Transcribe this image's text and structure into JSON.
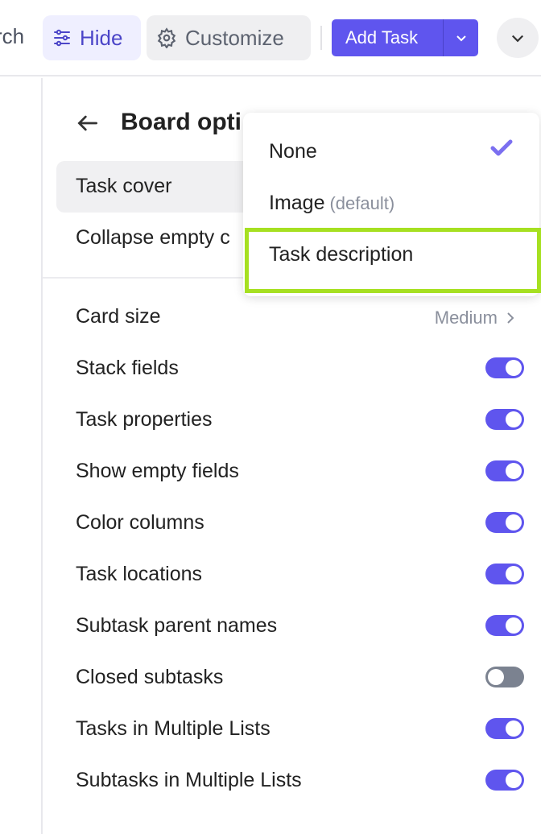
{
  "toolbar": {
    "search_label": "rch",
    "hide_label": "Hide",
    "customize_label": "Customize",
    "add_task_label": "Add Task"
  },
  "panel": {
    "title": "Board opti",
    "task_cover": "Task cover",
    "collapse_empty": "Collapse empty c",
    "card_size": {
      "label": "Card size",
      "value": "Medium"
    },
    "toggles": [
      {
        "label": "Stack fields",
        "on": true
      },
      {
        "label": "Task properties",
        "on": true
      },
      {
        "label": "Show empty fields",
        "on": true
      },
      {
        "label": "Color columns",
        "on": true
      },
      {
        "label": "Task locations",
        "on": true
      },
      {
        "label": "Subtask parent names",
        "on": true
      },
      {
        "label": "Closed subtasks",
        "on": false
      },
      {
        "label": "Tasks in Multiple Lists",
        "on": true
      },
      {
        "label": "Subtasks in Multiple Lists",
        "on": true
      }
    ]
  },
  "dropdown": {
    "options": [
      {
        "label": "None",
        "selected": true
      },
      {
        "label": "Image",
        "note": "(default)"
      },
      {
        "label": "Task description",
        "highlighted": true
      }
    ]
  },
  "colors": {
    "accent": "#5f55ee",
    "highlight": "#a6e021"
  }
}
